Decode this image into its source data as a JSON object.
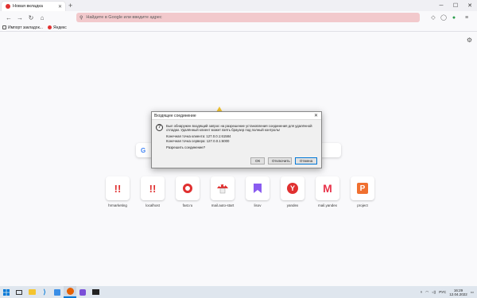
{
  "browser": {
    "tab_title": "Новая вкладка",
    "url_placeholder": "Найдите в Google или введите адрес",
    "bookmarks": [
      {
        "label": "Импорт закладок...",
        "icon": "import-icon"
      },
      {
        "label": "Яндекс",
        "icon": "yandex-icon"
      }
    ]
  },
  "tiles": [
    {
      "label": "hrmarketing",
      "icon": "exclamation-icon"
    },
    {
      "label": "localhost",
      "icon": "exclamation-icon"
    },
    {
      "label": "fast.ru",
      "icon": "beats-icon"
    },
    {
      "label": "mail.auto-start",
      "icon": "mushroom-icon"
    },
    {
      "label": "lisov",
      "icon": "bookmark-icon"
    },
    {
      "label": "yandex",
      "icon": "yandex-icon"
    },
    {
      "label": "mail.yandex",
      "icon": "m-icon"
    },
    {
      "label": "project",
      "icon": "p-icon"
    }
  ],
  "dialog": {
    "title": "Входящее соединение",
    "message_1": "Был обнаружен входящий запрос на разрешение установления соединения для удалённой отладки. Удалённый клиент может взять браузер под полный контроль!",
    "client_label": "Конечная точка клиента: 127.0.0.1:61584",
    "server_label": "Конечная точка сервера: 127.0.0.1:6000",
    "question": "Разрешить соединение?",
    "ok": "ОК",
    "disconnect": "Отключить",
    "cancel": "Отмена"
  },
  "taskbar": {
    "language": "РУС",
    "time": "16:29",
    "date": "12.04.2022"
  },
  "colors": {
    "urlbar_bg": "#f2c9cc",
    "accent_red": "#e03030",
    "taskbar_bg": "#dfe6ee"
  }
}
